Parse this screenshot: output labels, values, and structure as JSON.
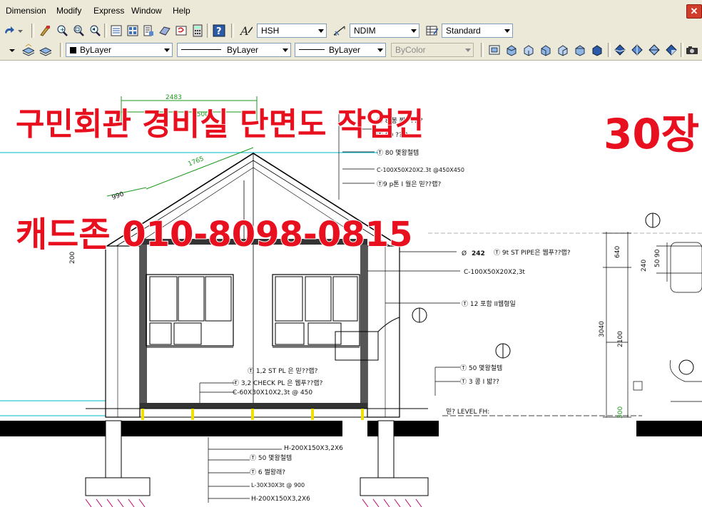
{
  "menu": {
    "items": [
      "Dimension",
      "Modify",
      "Express",
      "Window",
      "Help"
    ],
    "close_glyph": "✕"
  },
  "toolbar": {
    "text_style": "HSH",
    "dim_style": "NDIM",
    "table_style": "Standard",
    "layer_color": "ByLayer",
    "linetype": "ByLayer",
    "lineweight": "ByLayer",
    "plot_style": "ByColor"
  },
  "overlay": {
    "title": "구민회관 경비실 단면도 작업건",
    "count": "30장",
    "contact": "캐드존 010-8098-0815"
  },
  "drawing": {
    "dims": {
      "d2483": "2483",
      "d1500": "1500",
      "d1765": "1765",
      "d990": "990",
      "d200": "200",
      "d640": "640",
      "d240": "240",
      "d50": "50",
      "d90": "90",
      "d3040": "3040",
      "d2100": "2100",
      "d300": "300"
    },
    "notes": {
      "n1": "Ⓣ 8 봉 쬐? ?? ?",
      "n2": "Ⓣ 80 ?? ?",
      "n3": "Ⓣ 80 몇왕철템",
      "n4": "C-100X50X20X2.3t @450X450",
      "n5": "Ⓣ9 p톤 I 월은 믿??랩?",
      "n6a": "Ø",
      "n6b": "242",
      "n6c": "Ⓣ 9t ST PIPE은 웹푸??랩?",
      "n7": "C-100X50X20X2,3t",
      "n8": "Ⓣ 12 포함 II웹형일",
      "n9": "Ⓣ 1,2 ST PL 은 믿??랩?",
      "n10": "Ⓣ 3,2 CHECK PL 은 웹푸??랩?",
      "n11": "C-60X30X10X2,3t @ 450",
      "n12": "Ⓣ 50 몇왕철템",
      "n13": "Ⓣ 3 콩 I 밟??",
      "n14": "믿? LEVEL  FH:",
      "n15": "H-200X150X3,2X6",
      "n16": "Ⓣ 50 몇왕철템",
      "n17": "Ⓣ 6 쩔왕래?",
      "n18": "L-30X30X3t @ 900",
      "n19": "H-200X150X3,2X6"
    }
  },
  "colors": {
    "overlay_red": "#e8101e",
    "dim_green": "#1d9a1d",
    "grid_cyan": "#00b8c8",
    "chrome": "#ece9d8"
  },
  "icons": [
    "redo-icon",
    "match-properties-icon",
    "zoom-realtime-icon",
    "zoom-window-icon",
    "zoom-previous-icon",
    "properties-icon",
    "design-center-icon",
    "tool-palettes-icon",
    "sheet-set-icon",
    "markup-icon",
    "calculator-icon",
    "help-icon",
    "text-style-icon",
    "dim-style-icon",
    "table-style-icon",
    "layer-state-icon",
    "layer-previous-icon",
    "3d-view-icons",
    "shade-icons",
    "camera-icon"
  ]
}
